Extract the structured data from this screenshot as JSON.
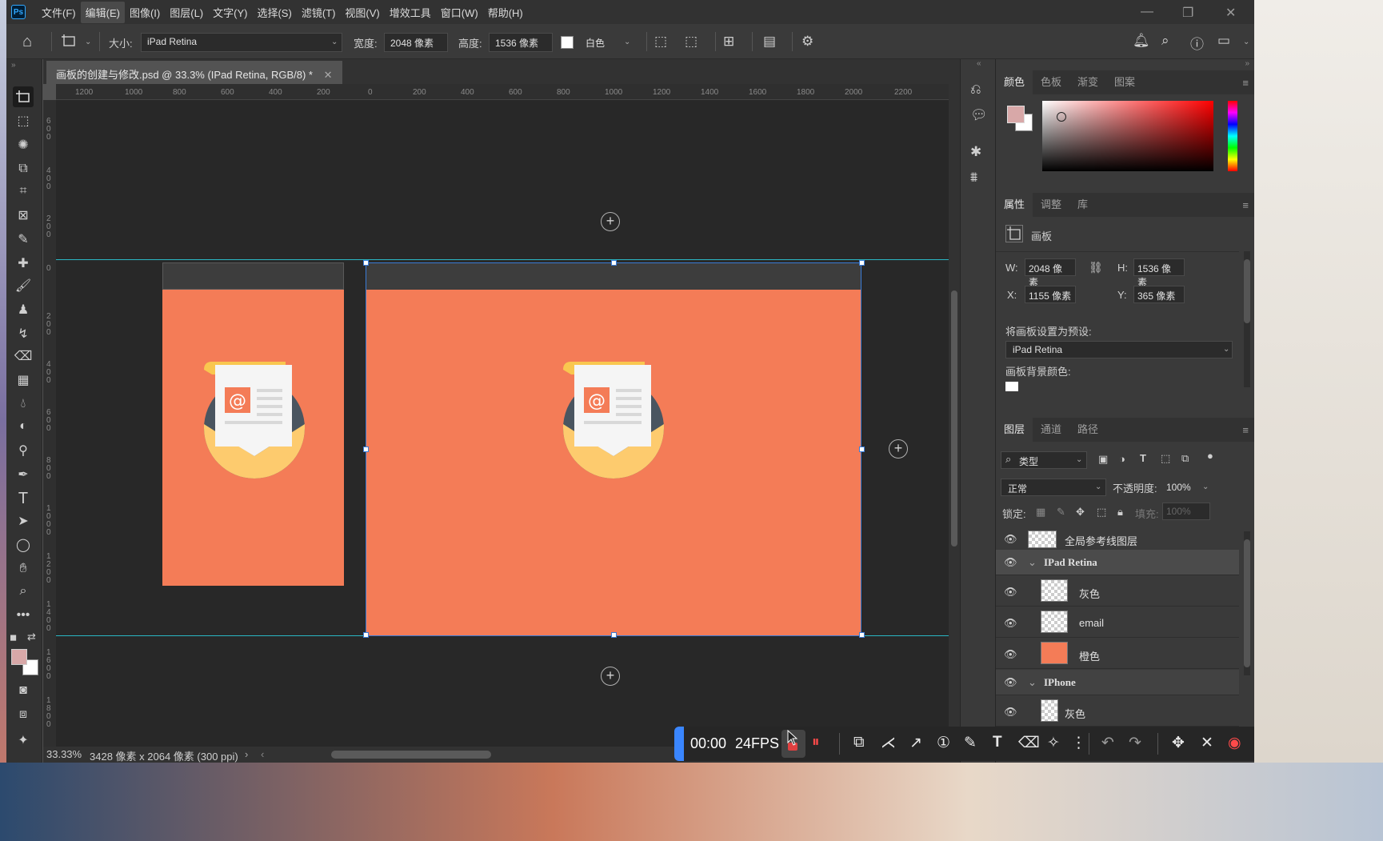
{
  "app": {
    "logo": "Ps"
  },
  "menu": [
    "文件(F)",
    "编辑(E)",
    "图像(I)",
    "图层(L)",
    "文字(Y)",
    "选择(S)",
    "滤镜(T)",
    "视图(V)",
    "增效工具",
    "窗口(W)",
    "帮助(H)"
  ],
  "options": {
    "size_label": "大小:",
    "size_value": "iPad Retina",
    "width_label": "宽度:",
    "width_value": "2048 像素",
    "height_label": "高度:",
    "height_value": "1536 像素",
    "bg_value": "白色"
  },
  "document": {
    "tab_title": "画板的创建与修改.psd @ 33.3% (IPad Retina, RGB/8) *",
    "ruler_h": [
      "1200",
      "1000",
      "800",
      "600",
      "400",
      "200",
      "0",
      "200",
      "400",
      "600",
      "800",
      "1000",
      "1200",
      "1400",
      "1600",
      "1800",
      "2000",
      "2200"
    ],
    "ruler_v": [
      "6\n0\n0",
      "4\n0\n0",
      "2\n0\n0",
      "0",
      "2\n0\n0",
      "4\n0\n0",
      "6\n0\n0",
      "8\n0\n0",
      "1\n0\n0\n0",
      "1\n2\n0\n0",
      "1\n4\n0\n0",
      "1\n6\n0\n0",
      "1\n8\n0\n0"
    ]
  },
  "status": {
    "zoom": "33.33%",
    "doc_size": "3428 像素 x 2064 像素 (300 ppi)"
  },
  "color_panel": {
    "tabs": [
      "颜色",
      "色板",
      "渐变",
      "图案"
    ]
  },
  "properties_panel": {
    "tabs": [
      "属性",
      "调整",
      "库"
    ],
    "type_label": "画板",
    "w_label": "W:",
    "w_value": "2048 像素",
    "h_label": "H:",
    "h_value": "1536 像素",
    "x_label": "X:",
    "x_value": "1155 像素",
    "y_label": "Y:",
    "y_value": "365 像素",
    "preset_label": "将画板设置为预设:",
    "preset_value": "iPad Retina",
    "bg_label": "画板背景颜色:"
  },
  "layers_panel": {
    "tabs": [
      "图层",
      "通道",
      "路径"
    ],
    "filter_value": "类型",
    "blend_mode": "正常",
    "opacity_label": "不透明度:",
    "opacity_value": "100%",
    "lock_label": "锁定:",
    "fill_label": "填充:",
    "fill_value": "100%",
    "layers": [
      {
        "name": "全局参考线图层"
      },
      {
        "name": "IPad Retina"
      },
      {
        "name": "灰色"
      },
      {
        "name": "email"
      },
      {
        "name": "橙色"
      },
      {
        "name": "IPhone"
      },
      {
        "name": "灰色"
      }
    ]
  },
  "recorder": {
    "time": "00:00",
    "fps": "24FPS"
  },
  "colors": {
    "artboard_fill": "#f47c57",
    "guide": "#2ab7c4",
    "selection": "#3a7bd5",
    "foreground_swatch": "#d8a8a8"
  }
}
